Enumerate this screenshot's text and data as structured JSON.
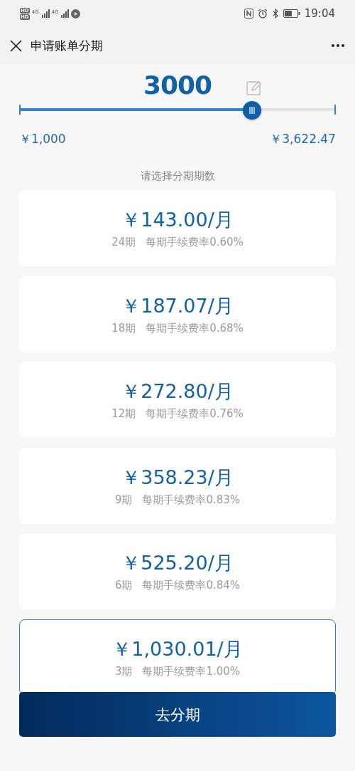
{
  "status_bar": {
    "network_labels": [
      "HD",
      "HD",
      "4G",
      "4G"
    ],
    "time": "19:04"
  },
  "header": {
    "title": "申请账单分期"
  },
  "amount": {
    "value": "3000",
    "level": 0.736,
    "min_label": "￥1,000",
    "max_label": "￥3,622.47"
  },
  "prompt": "请选择分期期数",
  "plans": [
    {
      "monthly": "￥143.00/月",
      "term": "24期",
      "fee": "每期手续费率0.60%",
      "selected": false
    },
    {
      "monthly": "￥187.07/月",
      "term": "18期",
      "fee": "每期手续费率0.68%",
      "selected": false
    },
    {
      "monthly": "￥272.80/月",
      "term": "12期",
      "fee": "每期手续费率0.76%",
      "selected": false
    },
    {
      "monthly": "￥358.23/月",
      "term": "9期",
      "fee": "每期手续费率0.83%",
      "selected": false
    },
    {
      "monthly": "￥525.20/月",
      "term": "6期",
      "fee": "每期手续费率0.84%",
      "selected": false
    },
    {
      "monthly": "￥1,030.01/月",
      "term": "3期",
      "fee": "每期手续费率1.00%",
      "selected": true
    }
  ],
  "submit_button": "去分期"
}
